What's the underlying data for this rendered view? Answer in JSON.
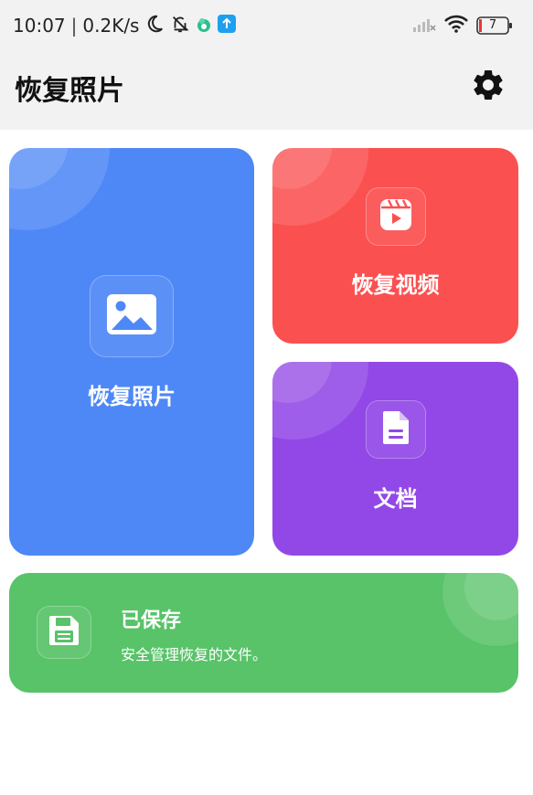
{
  "status_bar": {
    "time": "10:07",
    "network_speed": "0.2K/s",
    "battery_level": "7",
    "icons": [
      "moon-icon",
      "bell-off-icon",
      "app-notification-icon",
      "upload-notification-icon",
      "signal-icon",
      "wifi-icon",
      "battery-icon"
    ]
  },
  "app_bar": {
    "title": "恢复照片",
    "settings_icon": "gear-icon"
  },
  "cards": {
    "photos": {
      "label": "恢复照片",
      "icon": "image-icon",
      "color": "#4e88f6"
    },
    "videos": {
      "label": "恢复视频",
      "icon": "video-clip-icon",
      "color": "#fb5050"
    },
    "documents": {
      "label": "文档",
      "icon": "document-icon",
      "color": "#9248e6"
    },
    "saved": {
      "title": "已保存",
      "description": "安全管理恢复的文件。",
      "icon": "floppy-disk-icon",
      "color": "#58c368"
    }
  }
}
